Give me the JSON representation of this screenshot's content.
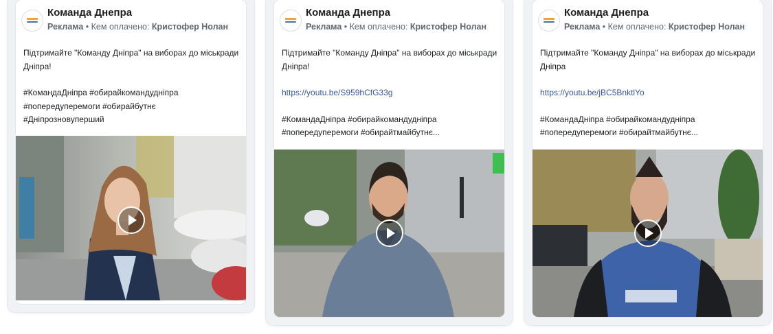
{
  "posts": [
    {
      "page_name": "Команда Днепра",
      "ad_label": "Реклама",
      "paid_by_prefix": " • Кем оплачено: ",
      "paid_by": "Кристофер Нолан",
      "line1": "Підтримайте \"Команду Дніпра\" на виборах до міськради",
      "line2": "Дніпра!",
      "link": "",
      "tags1": "#КомандаДніпра #обирайкомандудніпра",
      "tags2": "#попередуперемоги #обирайбутнє",
      "tags3": "#Дніпрозновуперший",
      "logo_icon": "team-dnipro-logo-icon",
      "play_icon": "play-icon"
    },
    {
      "page_name": "Команда Днепра",
      "ad_label": "Реклама",
      "paid_by_prefix": " • Кем оплачено: ",
      "paid_by": "Кристофер Нолан",
      "line1": "Підтримайте \"Команду Дніпра\" на виборах до міськради",
      "line2": "Дніпра!",
      "link": "https://youtu.be/S959hCfG33g",
      "tags1": "#КомандаДніпра #обирайкомандудніпра",
      "tags2": "#попередуперемоги #обирайтмайбутнє...",
      "tags3": "",
      "logo_icon": "team-dnipro-logo-icon",
      "play_icon": "play-icon"
    },
    {
      "page_name": "Команда Днепра",
      "ad_label": "Реклама",
      "paid_by_prefix": " • Кем оплачено: ",
      "paid_by": "Кристофер Нолан",
      "line1": "Підтримайте \"Команду Дніпра\" на виборах до міськради",
      "line2": "Дніпра",
      "link": "https://youtu.be/jBC5BnktlYo",
      "tags1": "#КомандаДніпра #обирайкомандудніпра",
      "tags2": "#попередуперемоги #обирайтмайбутнє...",
      "tags3": "",
      "logo_icon": "team-dnipro-logo-icon",
      "play_icon": "play-icon"
    }
  ]
}
